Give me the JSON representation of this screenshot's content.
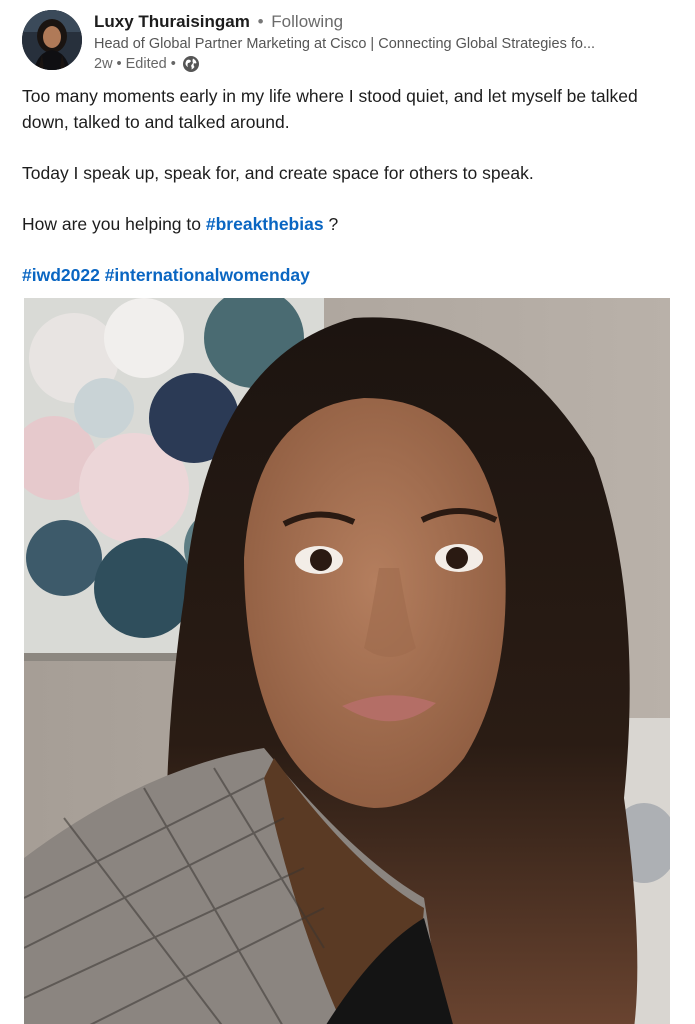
{
  "author": {
    "name": "Luxy Thuraisingam",
    "separator": "•",
    "follow_status": "Following",
    "headline": "Head of Global Partner Marketing at Cisco | Connecting Global Strategies fo...",
    "time_ago": "2w",
    "edited_label": "Edited",
    "visibility_icon": "globe-icon"
  },
  "post": {
    "line1": "Too many moments early in my life where I stood quiet, and let myself be talked down, talked to and talked around.",
    "line2": "Today I speak up, speak for, and create space for others to speak.",
    "question_prefix": "How are you helping to ",
    "question_hashtag": "#breakthebias",
    "question_suffix": " ?",
    "hashtags": [
      "#iwd2022",
      "#internationalwomenday"
    ]
  },
  "colors": {
    "link": "#0a66c2",
    "text": "#1d1d1d",
    "muted": "#666666"
  }
}
